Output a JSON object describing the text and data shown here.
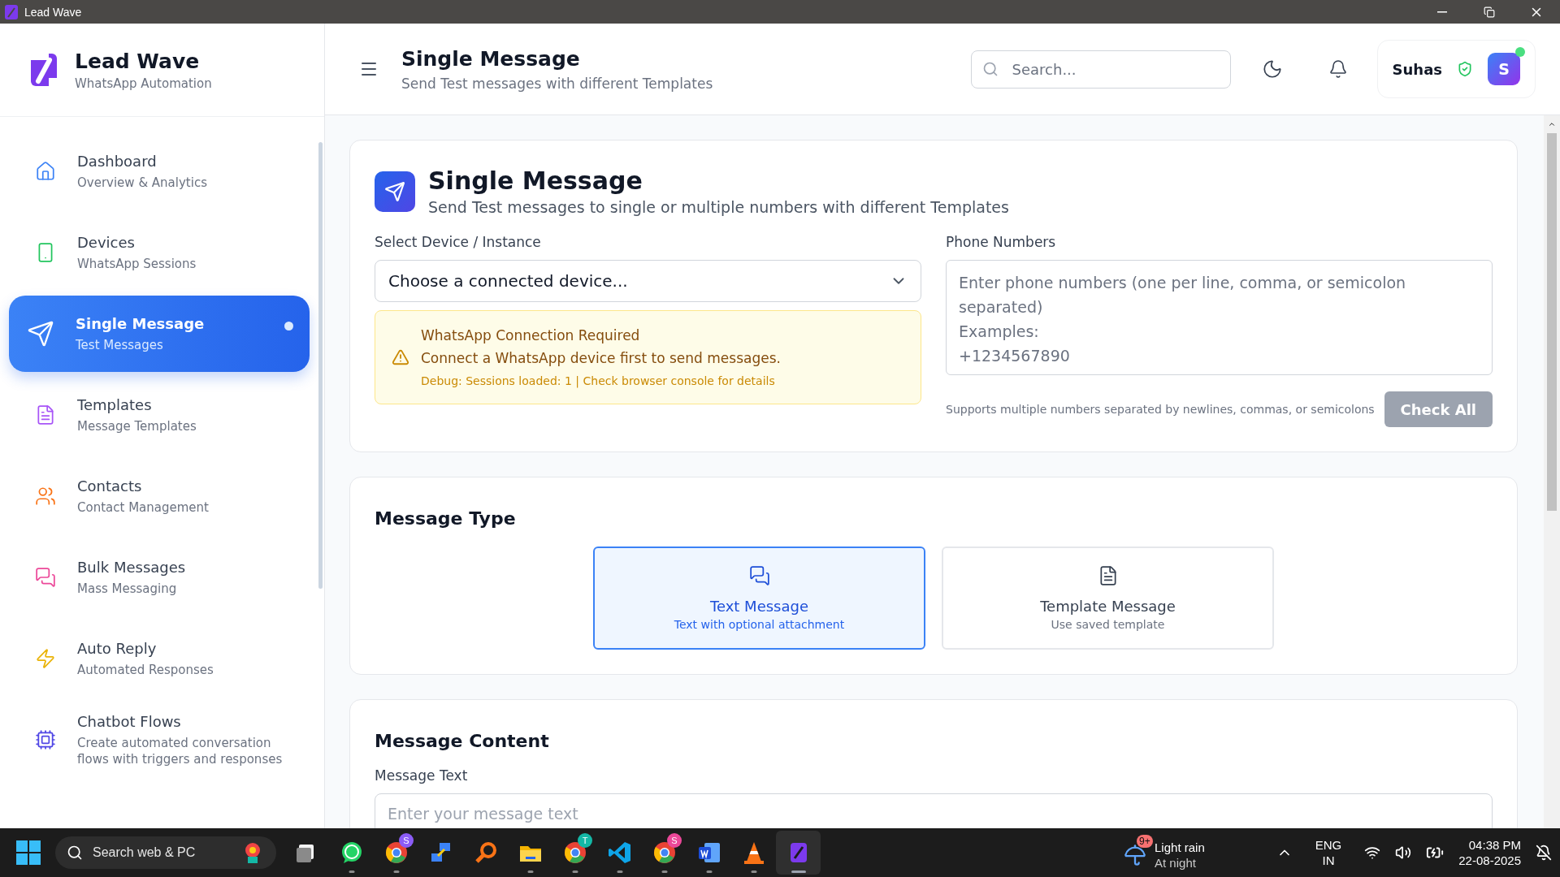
{
  "window": {
    "title": "Lead Wave"
  },
  "sidebar": {
    "brand": {
      "name": "Lead Wave",
      "tagline": "WhatsApp Automation"
    },
    "items": [
      {
        "label": "Dashboard",
        "sublabel": "Overview & Analytics",
        "selected": false
      },
      {
        "label": "Devices",
        "sublabel": "WhatsApp Sessions",
        "selected": false
      },
      {
        "label": "Single Message",
        "sublabel": "Test Messages",
        "selected": true
      },
      {
        "label": "Templates",
        "sublabel": "Message Templates",
        "selected": false
      },
      {
        "label": "Contacts",
        "sublabel": "Contact Management",
        "selected": false
      },
      {
        "label": "Bulk Messages",
        "sublabel": "Mass Messaging",
        "selected": false
      },
      {
        "label": "Auto Reply",
        "sublabel": "Automated Responses",
        "selected": false
      },
      {
        "label": "Chatbot Flows",
        "sublabel": "Create automated conversation flows with triggers and responses",
        "selected": false
      }
    ]
  },
  "header": {
    "title": "Single Message",
    "subtitle": "Send Test messages with different Templates",
    "search": {
      "placeholder": "Search..."
    },
    "user": {
      "name": "Suhas",
      "avatar": "S",
      "online": true
    }
  },
  "single_message": {
    "title": "Single Message",
    "subtitle": "Send Test messages to single or multiple numbers with different Templates",
    "device": {
      "label": "Select Device / Instance",
      "value": "Choose a connected device..."
    },
    "alert": {
      "title": "WhatsApp Connection Required",
      "message": "Connect a WhatsApp device first to send messages.",
      "debug": "Debug: Sessions loaded: 1 | Check browser console for details"
    },
    "phone": {
      "label": "Phone Numbers",
      "placeholder": "Enter phone numbers (one per line, comma, or semicolon separated)\nExamples:\n+1234567890",
      "hint": "Supports multiple numbers separated by newlines, commas, or semicolons"
    },
    "check_button": {
      "label": "Check All",
      "disabled": true
    }
  },
  "message_type": {
    "title": "Message Type",
    "options": [
      {
        "label": "Text Message",
        "description": "Text with optional attachment",
        "selected": true
      },
      {
        "label": "Template Message",
        "description": "Use saved template",
        "selected": false
      }
    ]
  },
  "message_content": {
    "title": "Message Content",
    "field_label": "Message Text",
    "placeholder": "Enter your message text"
  },
  "taskbar": {
    "search": {
      "placeholder": "Search web & PC"
    },
    "apps": [
      {
        "running": false
      },
      {
        "running": true
      },
      {
        "running": true,
        "badge": "S"
      },
      {
        "running": false
      },
      {
        "running": false
      },
      {
        "running": true
      },
      {
        "running": true,
        "badge": "T"
      },
      {
        "running": true
      },
      {
        "running": true,
        "badge": "S"
      },
      {
        "running": true
      },
      {
        "running": true
      },
      {
        "running": true,
        "selected": true
      }
    ],
    "weather": {
      "badge": "9+",
      "title": "Light rain",
      "subtitle": "At night"
    },
    "language": {
      "line1": "ENG",
      "line2": "IN"
    },
    "time": "04:38 PM",
    "date": "22-08-2025"
  }
}
